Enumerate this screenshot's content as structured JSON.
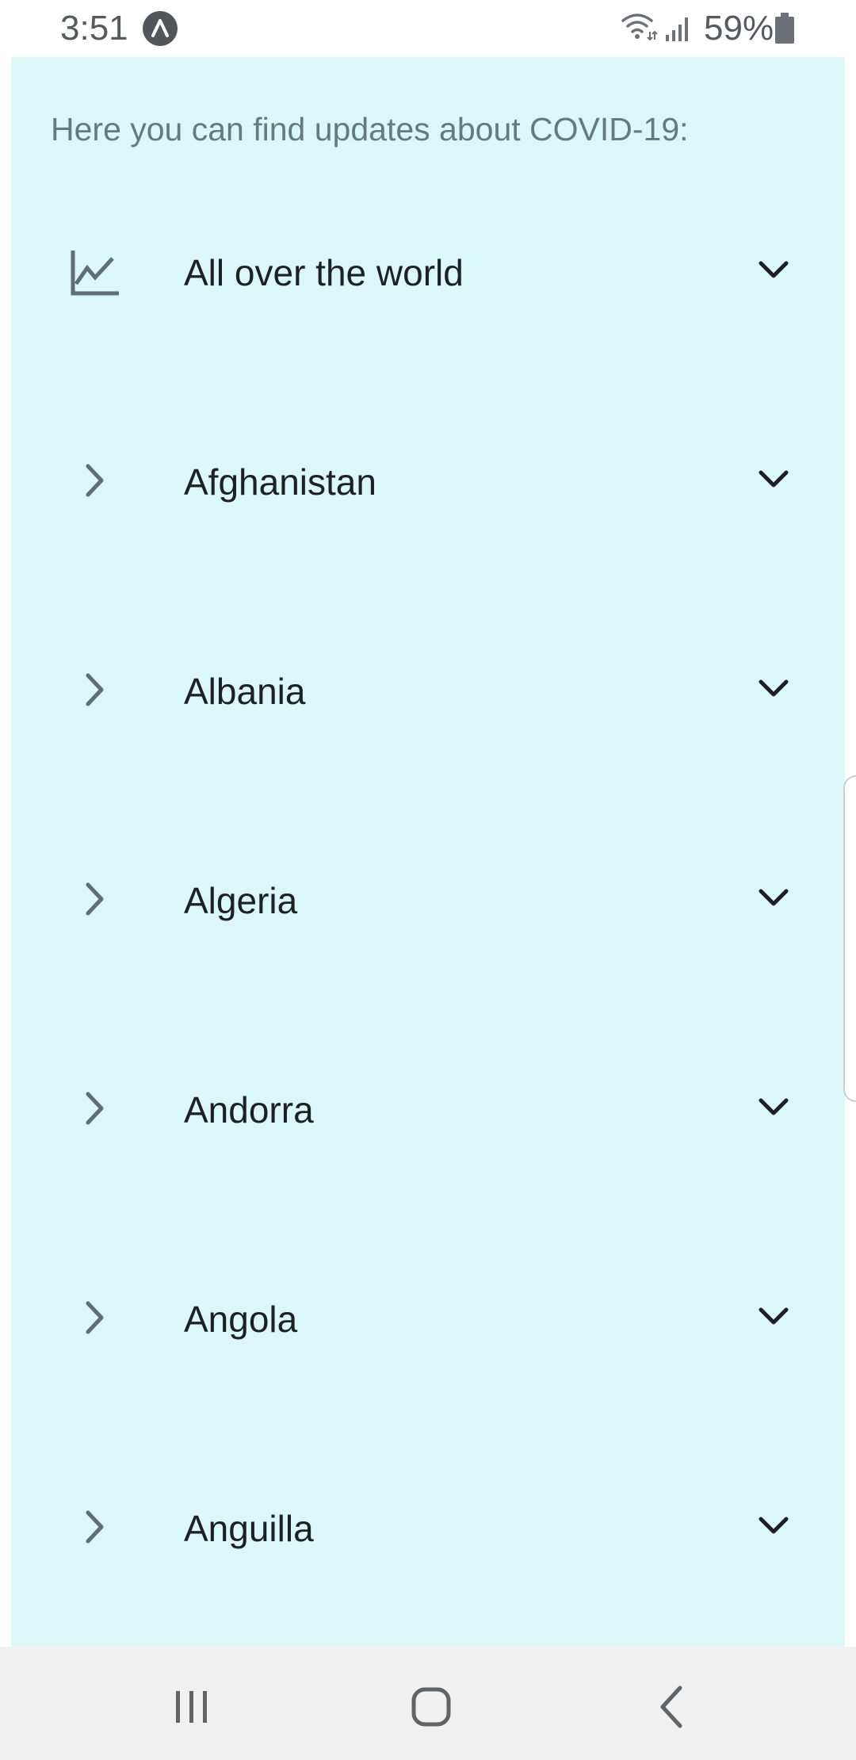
{
  "status_bar": {
    "time": "3:51",
    "battery": "59%",
    "icons": [
      "app-notification-icon",
      "wifi-icon",
      "signal-icon",
      "battery-icon"
    ]
  },
  "intro": "Here you can find updates about COVID-19:",
  "colors": {
    "panel_background": "#dcf7f7",
    "icon_gray": "#5f6f73",
    "text_dark": "#1c2124"
  },
  "rows": [
    {
      "label": "All over the world",
      "lead_icon": "chart-line-icon"
    },
    {
      "label": "Afghanistan",
      "lead_icon": "chevron-right-icon"
    },
    {
      "label": "Albania",
      "lead_icon": "chevron-right-icon"
    },
    {
      "label": "Algeria",
      "lead_icon": "chevron-right-icon"
    },
    {
      "label": "Andorra",
      "lead_icon": "chevron-right-icon"
    },
    {
      "label": "Angola",
      "lead_icon": "chevron-right-icon"
    },
    {
      "label": "Anguilla",
      "lead_icon": "chevron-right-icon"
    }
  ],
  "nav_bar": {
    "buttons": [
      "recents-icon",
      "home-icon",
      "back-icon"
    ]
  }
}
